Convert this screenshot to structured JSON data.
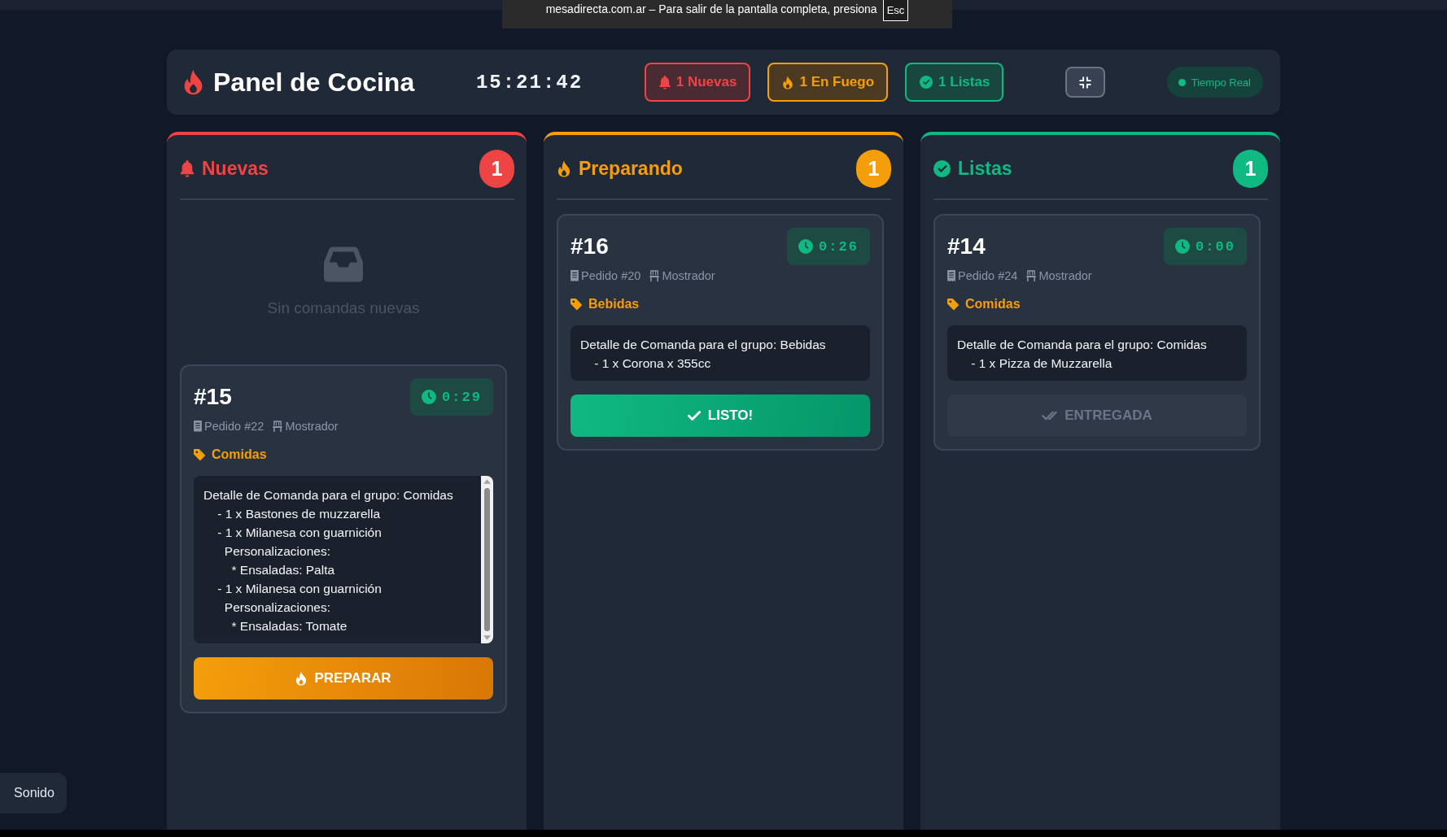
{
  "fullscreen_notice": {
    "text": "mesadirecta.com.ar – Para salir de la pantalla completa, presiona",
    "key": "Esc"
  },
  "header": {
    "title": "Panel de Cocina",
    "clock": "15:21:42",
    "stats": [
      {
        "kind": "new",
        "label": "1 Nuevas"
      },
      {
        "kind": "cooking",
        "label": "1 En Fuego"
      },
      {
        "kind": "ready",
        "label": "1 Listas"
      }
    ],
    "live_status": "Tiempo Real"
  },
  "columns": [
    {
      "kind": "new",
      "title": "Nuevas",
      "count": "1",
      "empty_message": "Sin comandas nuevas",
      "orders": [
        {
          "number": "#15",
          "timer": "0:29",
          "order_ref": "Pedido #22",
          "location": "Mostrador",
          "group": "Comidas",
          "detail": "Detalle de Comanda para el grupo: Comidas\n    - 1 x Bastones de muzzarella\n    - 1 x Milanesa con guarnición\n      Personalizaciones:\n        * Ensaladas: Palta\n    - 1 x Milanesa con guarnición\n      Personalizaciones:\n        * Ensaladas: Tomate",
          "scrollable": true,
          "action": {
            "kind": "start",
            "label": "PREPARAR",
            "disabled": false
          }
        }
      ]
    },
    {
      "kind": "cooking",
      "title": "Preparando",
      "count": "1",
      "orders": [
        {
          "number": "#16",
          "timer": "0:26",
          "order_ref": "Pedido #20",
          "location": "Mostrador",
          "group": "Bebidas",
          "detail": "Detalle de Comanda para el grupo: Bebidas\n    - 1 x Corona x 355cc",
          "scrollable": false,
          "action": {
            "kind": "ready",
            "label": "LISTO!",
            "disabled": false
          }
        }
      ]
    },
    {
      "kind": "ready",
      "title": "Listas",
      "count": "1",
      "orders": [
        {
          "number": "#14",
          "timer": "0:00",
          "order_ref": "Pedido #24",
          "location": "Mostrador",
          "group": "Comidas",
          "detail": "Detalle de Comanda para el grupo: Comidas\n    - 1 x Pizza de Muzzarella",
          "scrollable": false,
          "action": {
            "kind": "deliver",
            "label": "ENTREGADA",
            "disabled": true
          }
        }
      ]
    }
  ],
  "sound_button": "Sonido"
}
